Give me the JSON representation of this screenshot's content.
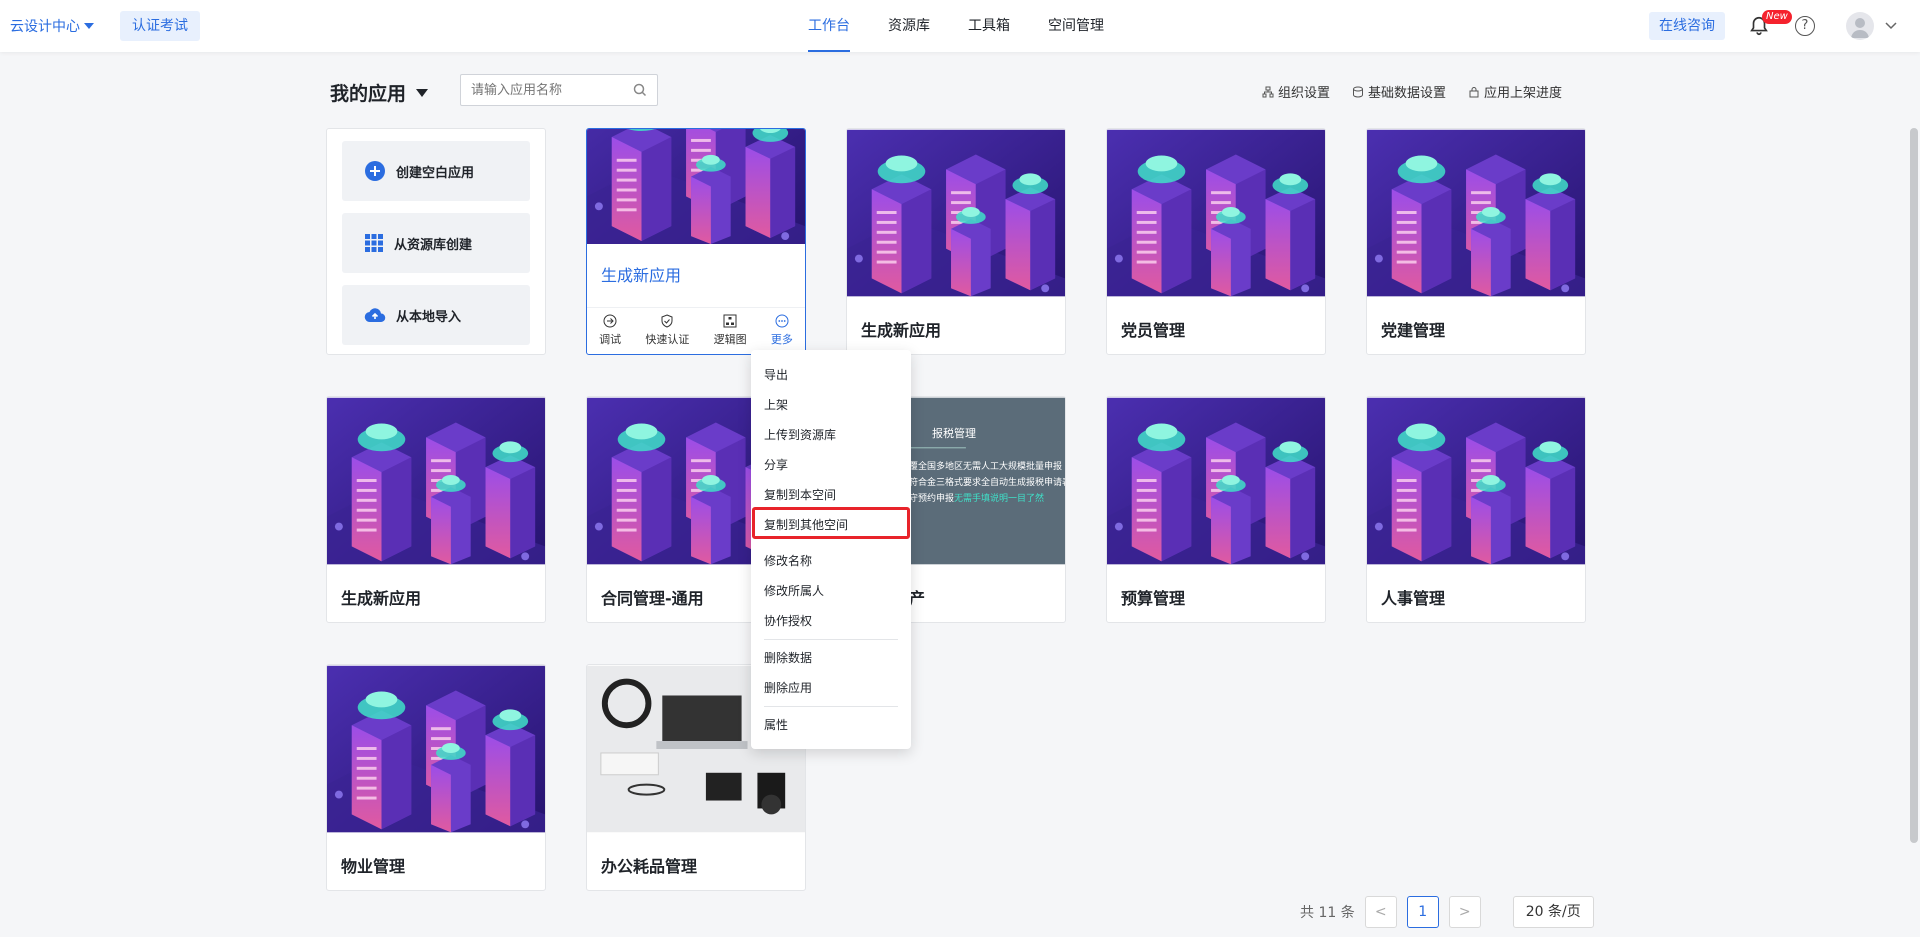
{
  "topbar": {
    "brand": "云设计中心",
    "cert_exam": "认证考试",
    "nav": [
      "工作台",
      "资源库",
      "工具箱",
      "空间管理"
    ],
    "active_nav": "工作台",
    "consult": "在线咨询",
    "new_badge": "New",
    "help": "?"
  },
  "header": {
    "title": "我的应用",
    "search_placeholder": "请输入应用名称",
    "links": [
      "组织设置",
      "基础数据设置",
      "应用上架进度"
    ]
  },
  "create": {
    "blank": "创建空白应用",
    "from_repo": "从资源库创建",
    "local_import": "从本地导入"
  },
  "selected_card": {
    "name": "生成新应用",
    "actions": [
      "调试",
      "快速认证",
      "逻辑图",
      "更多"
    ]
  },
  "cards": [
    "生成新应用",
    "党员管理",
    "党建管理",
    "生成新应用",
    "合同管理-通用",
    "产",
    "预算管理",
    "人事管理",
    "物业管理",
    "办公耗品管理"
  ],
  "tax_thumb": {
    "title": "报税管理",
    "line1": "覆全国多地区无需人工大规模批量申报",
    "line2": "符合金三格式要求全自动生成报税申请表",
    "line3_a": "守预约申报",
    "line3_b": "无需手填说明一目了然"
  },
  "menu": {
    "items": [
      "导出",
      "上架",
      "上传到资源库",
      "分享",
      "复制到本空间",
      "复制到其他空间",
      "修改名称",
      "修改所属人",
      "协作授权",
      "删除数据",
      "删除应用",
      "属性"
    ],
    "highlighted": "复制到其他空间"
  },
  "pagination": {
    "total": "共 11 条",
    "prev": "<",
    "current": "1",
    "next": ">",
    "page_size": "20 条/页"
  },
  "colors": {
    "primary": "#2b6de0",
    "highlight_border": "#e8232a"
  }
}
